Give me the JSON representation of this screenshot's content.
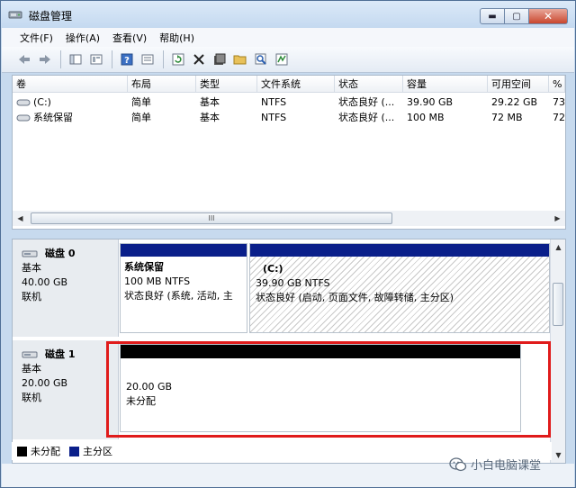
{
  "window": {
    "title": "磁盘管理"
  },
  "menu": [
    "文件(F)",
    "操作(A)",
    "查看(V)",
    "帮助(H)"
  ],
  "toolbar": [
    "back-icon",
    "forward-icon",
    "console-tree-icon",
    "properties-icon",
    "help-icon",
    "refresh-icon",
    "delete-icon",
    "shell-icon",
    "open-icon",
    "search-icon",
    "settings-icon"
  ],
  "volumes": {
    "columns": [
      "卷",
      "布局",
      "类型",
      "文件系统",
      "状态",
      "容量",
      "可用空间",
      "%"
    ],
    "rows": [
      [
        "(C:)",
        "简单",
        "基本",
        "NTFS",
        "状态良好 (...",
        "39.90 GB",
        "29.22 GB",
        "73"
      ],
      [
        "系统保留",
        "简单",
        "基本",
        "NTFS",
        "状态良好 (...",
        "100 MB",
        "72 MB",
        "72"
      ]
    ],
    "scroll_glyph": "III"
  },
  "disks": [
    {
      "title": "磁盘 0",
      "type": "基本",
      "size": "40.00 GB",
      "status": "联机",
      "partitions": [
        {
          "name": "系统保留",
          "size_fs": "100 MB NTFS",
          "status": "状态良好 (系统, 活动, 主",
          "bar_color": "#0a1f8a"
        },
        {
          "name": "(C:)",
          "size_fs": "39.90 GB NTFS",
          "status": "状态良好 (启动, 页面文件, 故障转储, 主分区)",
          "bar_color": "#0a1f8a"
        }
      ]
    },
    {
      "title": "磁盘 1",
      "type": "基本",
      "size": "20.00 GB",
      "status": "联机",
      "partitions": [
        {
          "size": "20.00 GB",
          "status": "未分配",
          "bar_color": "#000000"
        }
      ]
    }
  ],
  "legend": [
    {
      "label": "未分配",
      "color": "#000000"
    },
    {
      "label": "主分区",
      "color": "#0a1f8a"
    }
  ],
  "watermark": "小白电脑课堂",
  "colors": {
    "highlight": "#e01b1b",
    "primary_partition": "#0a1f8a",
    "unallocated": "#000000"
  }
}
